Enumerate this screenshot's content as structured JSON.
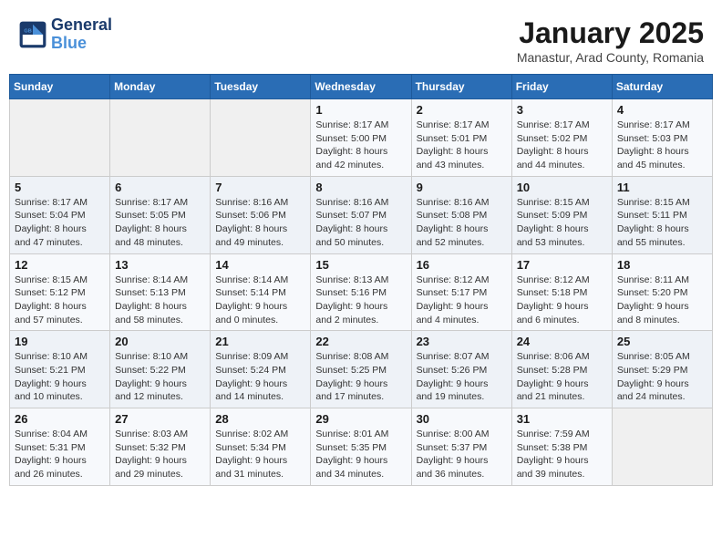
{
  "header": {
    "logo_line1": "General",
    "logo_line2": "Blue",
    "month_title": "January 2025",
    "subtitle": "Manastur, Arad County, Romania"
  },
  "weekdays": [
    "Sunday",
    "Monday",
    "Tuesday",
    "Wednesday",
    "Thursday",
    "Friday",
    "Saturday"
  ],
  "weeks": [
    [
      {
        "day": "",
        "info": ""
      },
      {
        "day": "",
        "info": ""
      },
      {
        "day": "",
        "info": ""
      },
      {
        "day": "1",
        "info": "Sunrise: 8:17 AM\nSunset: 5:00 PM\nDaylight: 8 hours and 42 minutes."
      },
      {
        "day": "2",
        "info": "Sunrise: 8:17 AM\nSunset: 5:01 PM\nDaylight: 8 hours and 43 minutes."
      },
      {
        "day": "3",
        "info": "Sunrise: 8:17 AM\nSunset: 5:02 PM\nDaylight: 8 hours and 44 minutes."
      },
      {
        "day": "4",
        "info": "Sunrise: 8:17 AM\nSunset: 5:03 PM\nDaylight: 8 hours and 45 minutes."
      }
    ],
    [
      {
        "day": "5",
        "info": "Sunrise: 8:17 AM\nSunset: 5:04 PM\nDaylight: 8 hours and 47 minutes."
      },
      {
        "day": "6",
        "info": "Sunrise: 8:17 AM\nSunset: 5:05 PM\nDaylight: 8 hours and 48 minutes."
      },
      {
        "day": "7",
        "info": "Sunrise: 8:16 AM\nSunset: 5:06 PM\nDaylight: 8 hours and 49 minutes."
      },
      {
        "day": "8",
        "info": "Sunrise: 8:16 AM\nSunset: 5:07 PM\nDaylight: 8 hours and 50 minutes."
      },
      {
        "day": "9",
        "info": "Sunrise: 8:16 AM\nSunset: 5:08 PM\nDaylight: 8 hours and 52 minutes."
      },
      {
        "day": "10",
        "info": "Sunrise: 8:15 AM\nSunset: 5:09 PM\nDaylight: 8 hours and 53 minutes."
      },
      {
        "day": "11",
        "info": "Sunrise: 8:15 AM\nSunset: 5:11 PM\nDaylight: 8 hours and 55 minutes."
      }
    ],
    [
      {
        "day": "12",
        "info": "Sunrise: 8:15 AM\nSunset: 5:12 PM\nDaylight: 8 hours and 57 minutes."
      },
      {
        "day": "13",
        "info": "Sunrise: 8:14 AM\nSunset: 5:13 PM\nDaylight: 8 hours and 58 minutes."
      },
      {
        "day": "14",
        "info": "Sunrise: 8:14 AM\nSunset: 5:14 PM\nDaylight: 9 hours and 0 minutes."
      },
      {
        "day": "15",
        "info": "Sunrise: 8:13 AM\nSunset: 5:16 PM\nDaylight: 9 hours and 2 minutes."
      },
      {
        "day": "16",
        "info": "Sunrise: 8:12 AM\nSunset: 5:17 PM\nDaylight: 9 hours and 4 minutes."
      },
      {
        "day": "17",
        "info": "Sunrise: 8:12 AM\nSunset: 5:18 PM\nDaylight: 9 hours and 6 minutes."
      },
      {
        "day": "18",
        "info": "Sunrise: 8:11 AM\nSunset: 5:20 PM\nDaylight: 9 hours and 8 minutes."
      }
    ],
    [
      {
        "day": "19",
        "info": "Sunrise: 8:10 AM\nSunset: 5:21 PM\nDaylight: 9 hours and 10 minutes."
      },
      {
        "day": "20",
        "info": "Sunrise: 8:10 AM\nSunset: 5:22 PM\nDaylight: 9 hours and 12 minutes."
      },
      {
        "day": "21",
        "info": "Sunrise: 8:09 AM\nSunset: 5:24 PM\nDaylight: 9 hours and 14 minutes."
      },
      {
        "day": "22",
        "info": "Sunrise: 8:08 AM\nSunset: 5:25 PM\nDaylight: 9 hours and 17 minutes."
      },
      {
        "day": "23",
        "info": "Sunrise: 8:07 AM\nSunset: 5:26 PM\nDaylight: 9 hours and 19 minutes."
      },
      {
        "day": "24",
        "info": "Sunrise: 8:06 AM\nSunset: 5:28 PM\nDaylight: 9 hours and 21 minutes."
      },
      {
        "day": "25",
        "info": "Sunrise: 8:05 AM\nSunset: 5:29 PM\nDaylight: 9 hours and 24 minutes."
      }
    ],
    [
      {
        "day": "26",
        "info": "Sunrise: 8:04 AM\nSunset: 5:31 PM\nDaylight: 9 hours and 26 minutes."
      },
      {
        "day": "27",
        "info": "Sunrise: 8:03 AM\nSunset: 5:32 PM\nDaylight: 9 hours and 29 minutes."
      },
      {
        "day": "28",
        "info": "Sunrise: 8:02 AM\nSunset: 5:34 PM\nDaylight: 9 hours and 31 minutes."
      },
      {
        "day": "29",
        "info": "Sunrise: 8:01 AM\nSunset: 5:35 PM\nDaylight: 9 hours and 34 minutes."
      },
      {
        "day": "30",
        "info": "Sunrise: 8:00 AM\nSunset: 5:37 PM\nDaylight: 9 hours and 36 minutes."
      },
      {
        "day": "31",
        "info": "Sunrise: 7:59 AM\nSunset: 5:38 PM\nDaylight: 9 hours and 39 minutes."
      },
      {
        "day": "",
        "info": ""
      }
    ]
  ]
}
